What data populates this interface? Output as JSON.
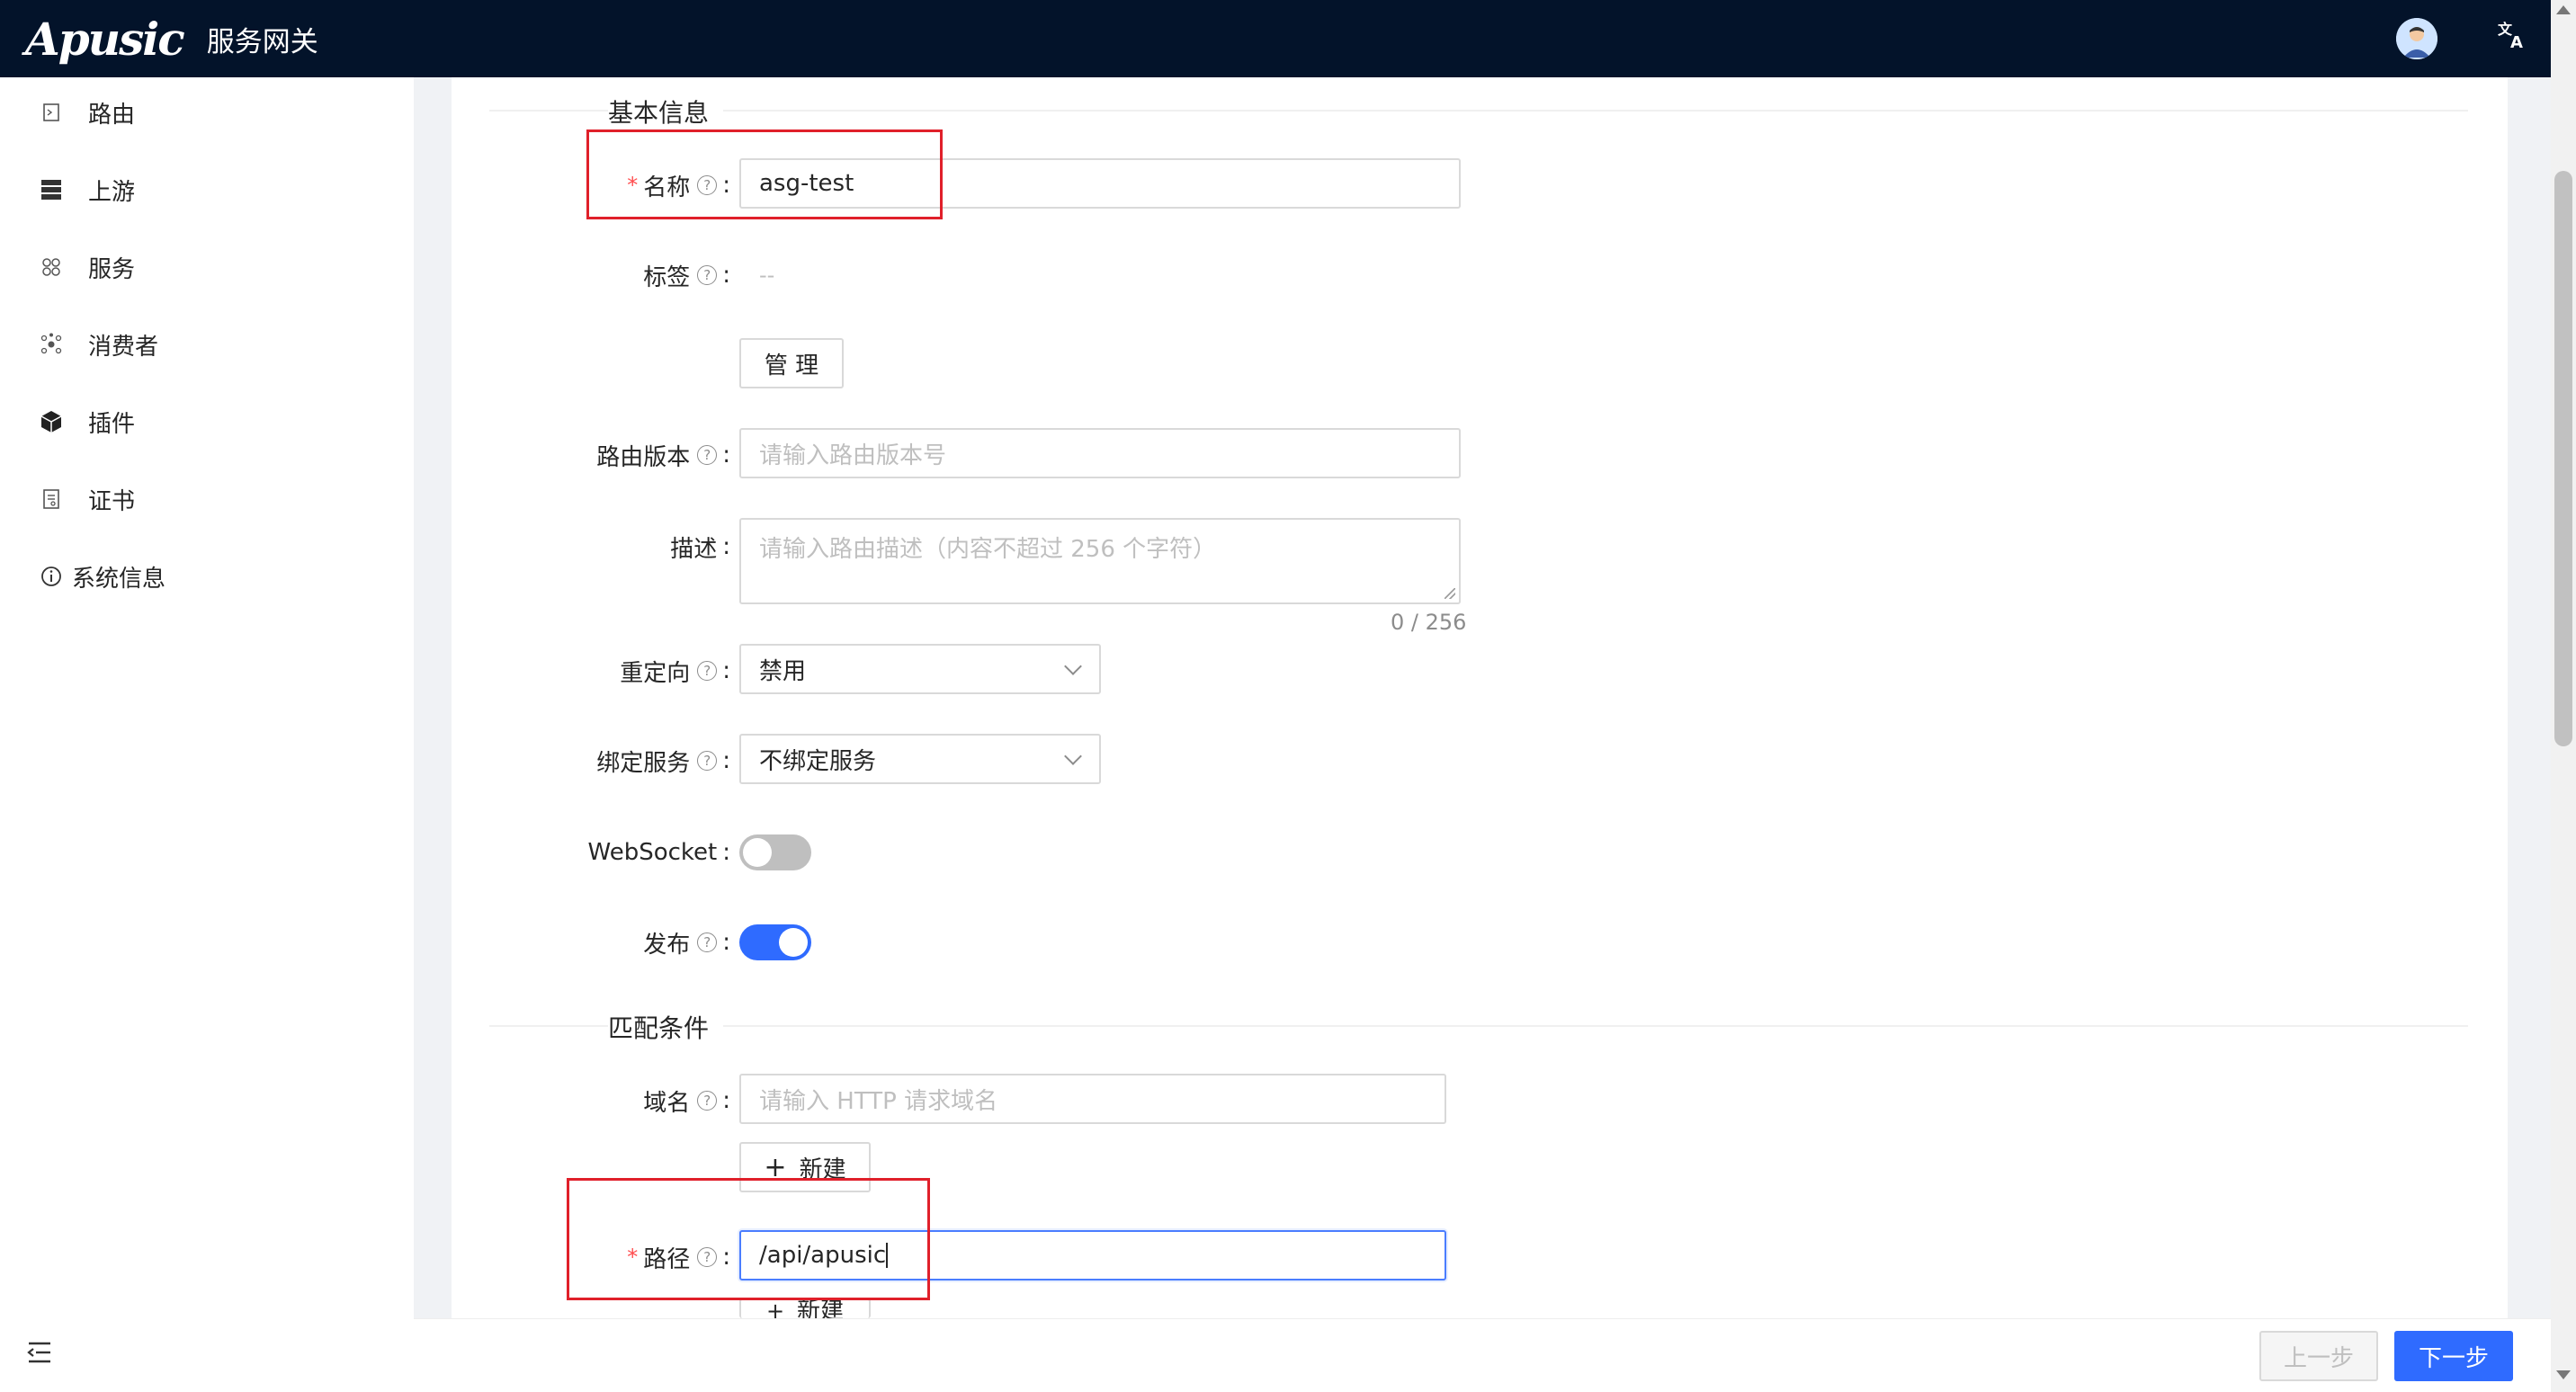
{
  "header": {
    "logo_text": "Apusic",
    "title": "服务网关",
    "avatar_icon": "user-avatar",
    "lang_icon_text": "文A"
  },
  "sidebar": {
    "items": [
      {
        "label": "路由",
        "icon": "route-icon"
      },
      {
        "label": "上游",
        "icon": "upstream-icon"
      },
      {
        "label": "服务",
        "icon": "service-icon"
      },
      {
        "label": "消费者",
        "icon": "consumer-icon"
      },
      {
        "label": "插件",
        "icon": "plugin-icon"
      },
      {
        "label": "证书",
        "icon": "certificate-icon"
      },
      {
        "label": "系统信息",
        "icon": "info-icon"
      }
    ]
  },
  "form": {
    "basic_section": "基本信息",
    "name_label": "名称",
    "name_value": "asg-test",
    "tags_label": "标签",
    "tags_value": "--",
    "manage_button": "管 理",
    "version_label": "路由版本",
    "version_placeholder": "请输入路由版本号",
    "desc_label": "描述",
    "desc_placeholder": "请输入路由描述（内容不超过 256 个字符）",
    "desc_count": "0 / 256",
    "redirect_label": "重定向",
    "redirect_value": "禁用",
    "bind_service_label": "绑定服务",
    "bind_service_value": "不绑定服务",
    "websocket_label": "WebSocket",
    "websocket_on": false,
    "publish_label": "发布",
    "publish_on": true,
    "match_section": "匹配条件",
    "domain_label": "域名",
    "domain_placeholder": "请输入 HTTP 请求域名",
    "new_button": "新建",
    "path_label": "路径",
    "path_value": "/api/apusic",
    "new_button_2": "新建"
  },
  "footer": {
    "prev_button": "上一步",
    "next_button": "下一步"
  },
  "colors": {
    "header_bg": "#03132a",
    "primary": "#2f6bff",
    "highlight": "#e0202a",
    "required": "#ff4d4f"
  }
}
